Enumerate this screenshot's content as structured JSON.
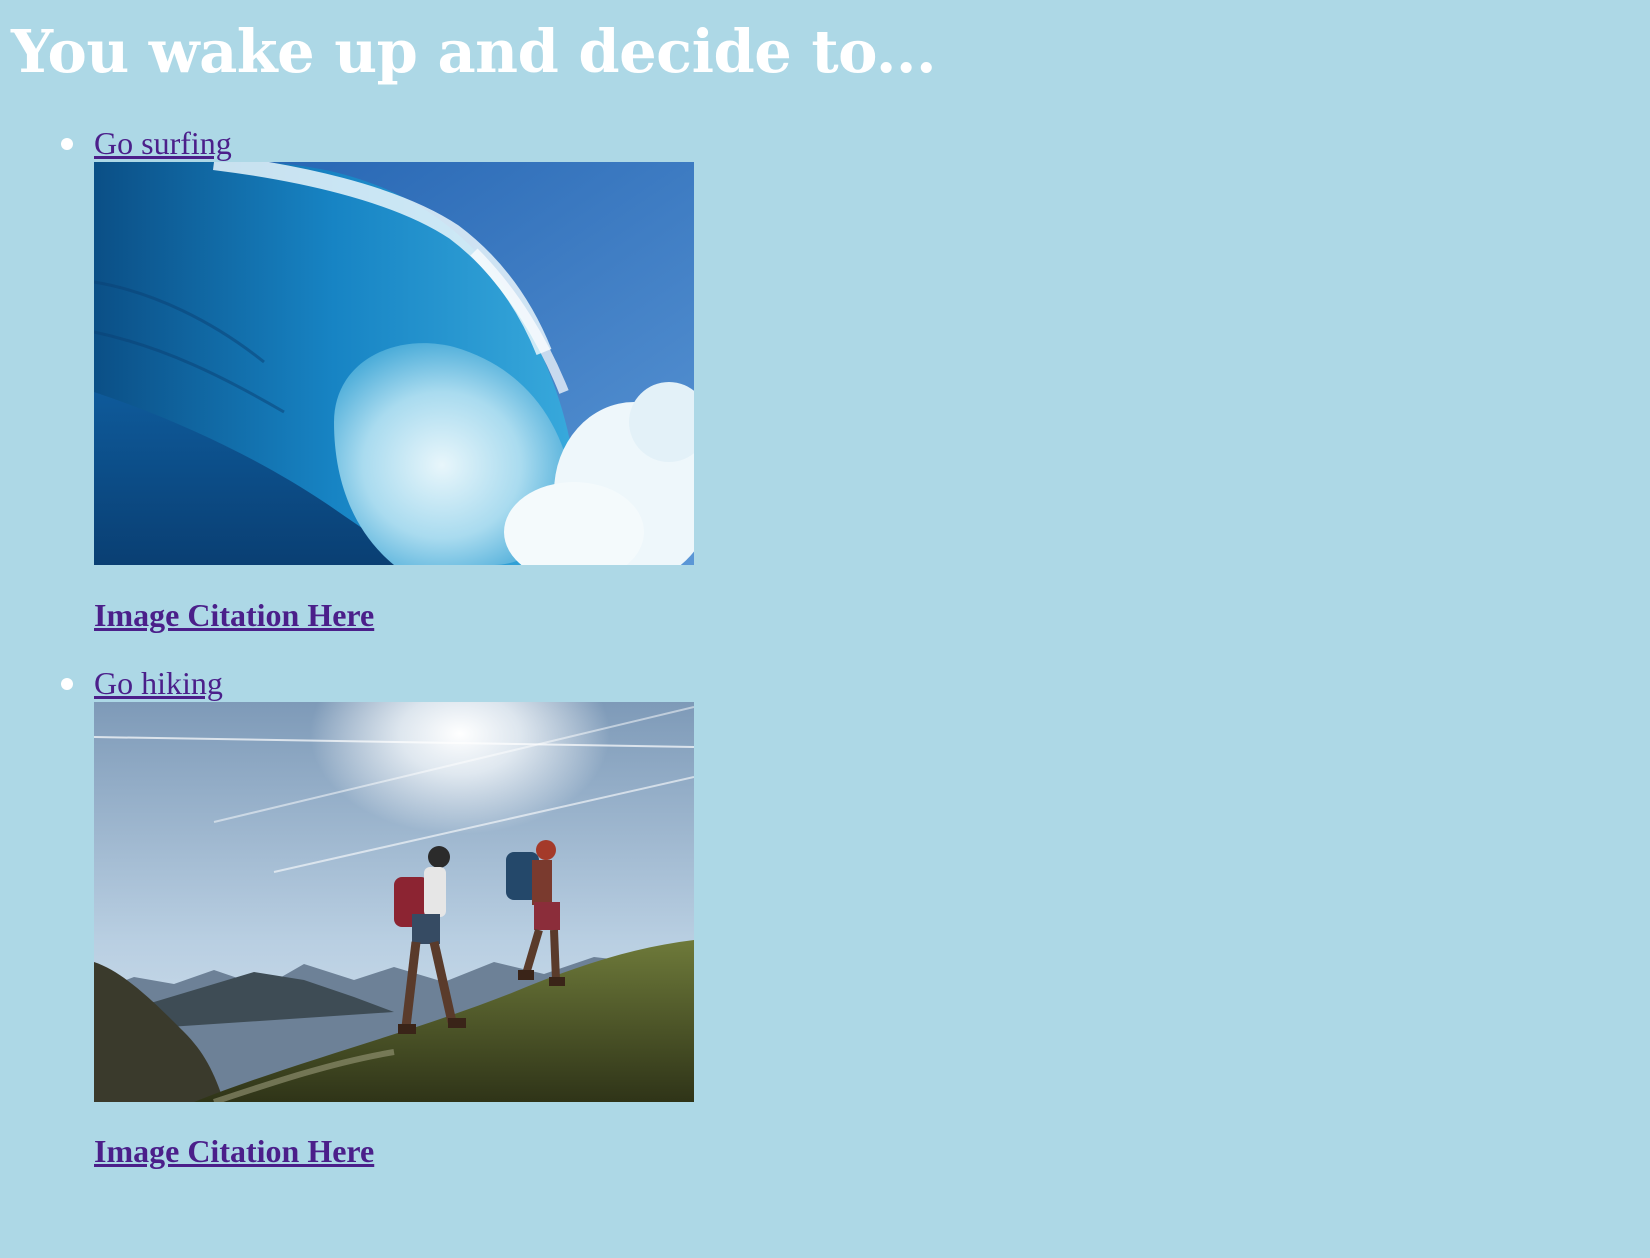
{
  "page": {
    "title": "You wake up and decide to...",
    "background_color": "#add8e6",
    "title_color": "#ffffff",
    "link_color": "#4b1f8a"
  },
  "options": [
    {
      "label": "Go surfing",
      "image_icon": "ocean-wave-photo",
      "citation_label": "Image Citation Here"
    },
    {
      "label": "Go hiking",
      "image_icon": "hikers-mountain-photo",
      "citation_label": "Image Citation Here"
    }
  ]
}
